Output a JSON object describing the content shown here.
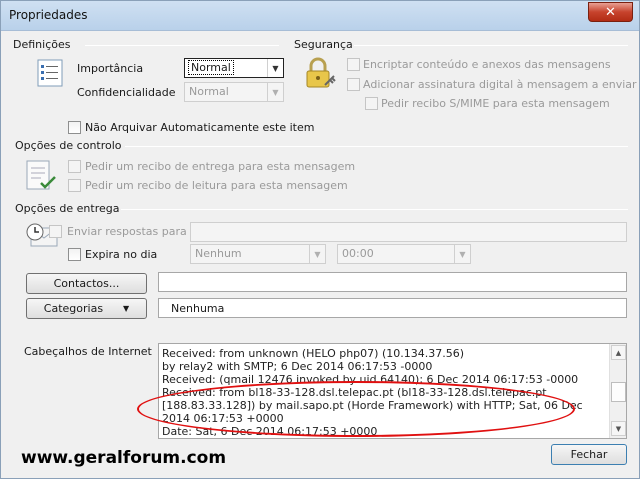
{
  "window": {
    "title": "Propriedades",
    "close_glyph": "✕"
  },
  "definicoes": {
    "title": "Definições",
    "importancia_label": "Importância",
    "importancia_value": "Normal",
    "confidencialidade_label": "Confidencialidade",
    "confidencialidade_value": "Normal",
    "nao_arquivar_label": "Não Arquivar Automaticamente este item"
  },
  "seguranca": {
    "title": "Segurança",
    "encriptar_label": "Encriptar conteúdo e anexos das mensagens",
    "assinatura_label": "Adicionar assinatura digital à mensagem a enviar",
    "smime_label": "Pedir recibo S/MIME para esta mensagem"
  },
  "controlo": {
    "title": "Opções de controlo",
    "recibo_entrega_label": "Pedir um recibo de entrega para esta mensagem",
    "recibo_leitura_label": "Pedir um recibo de leitura para esta mensagem"
  },
  "entrega": {
    "title": "Opções de entrega",
    "enviar_respostas_label": "Enviar respostas para",
    "expira_label": "Expira no dia",
    "expira_data_value": "Nenhum",
    "expira_hora_value": "00:00"
  },
  "contactos": {
    "button_label": "Contactos...",
    "value": ""
  },
  "categorias": {
    "button_label": "Categorias",
    "value": "Nenhuma"
  },
  "cabecalhos": {
    "label": "Cabeçalhos de Internet",
    "lines": [
      "Received: from unknown (HELO php07) (10.134.37.56)",
      "  by relay2 with SMTP; 6 Dec 2014 06:17:53 -0000",
      "Received: (qmail 12476 invoked by uid 64140); 6 Dec 2014 06:17:53 -0000",
      "Received: from bl18-33-128.dsl.telepac.pt (bl18-33-128.dsl.telepac.pt",
      "[188.83.33.128]) by mail.sapo.pt (Horde Framework) with HTTP; Sat, 06 Dec",
      "2014 06:17:53 +0000",
      "Date: Sat, 6 Dec 2014 06:17:53 +0000"
    ]
  },
  "footer": {
    "fechar_label": "Fechar",
    "watermark": "www.geralforum.com"
  }
}
